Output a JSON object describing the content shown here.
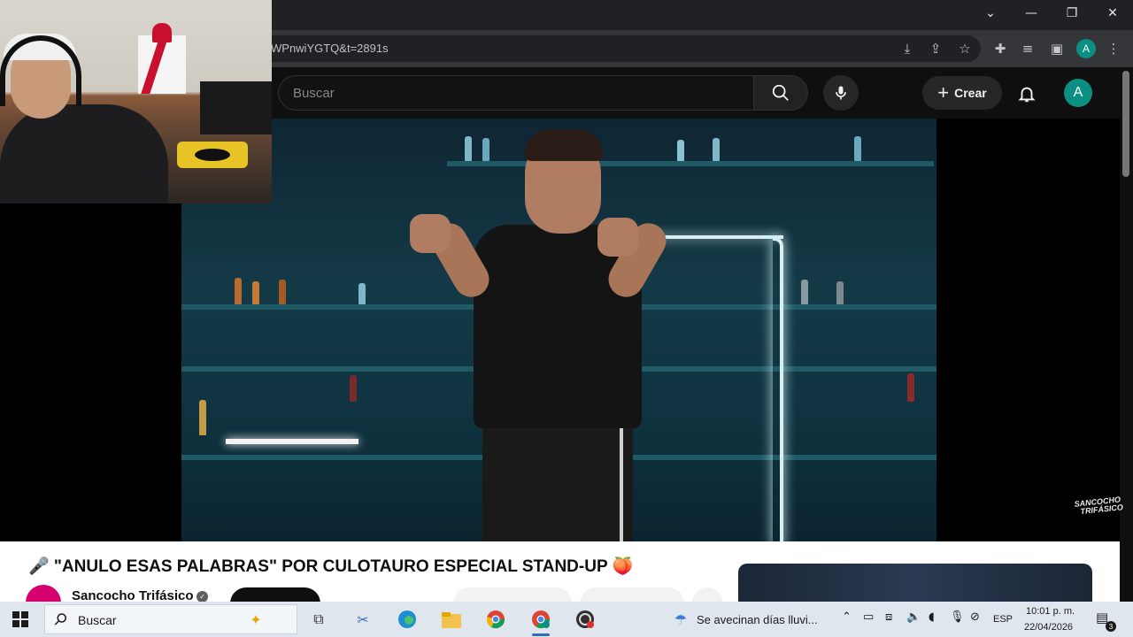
{
  "browser": {
    "url": "WPnwiYGTQ&t=2891s",
    "profile_initial": "A",
    "window_controls": [
      "chevron-down",
      "minimize",
      "restore",
      "close"
    ]
  },
  "youtube": {
    "search_placeholder": "Buscar",
    "create_label": "Crear",
    "avatar_initial": "A",
    "video_watermark_line1": "SANCOCHO",
    "video_watermark_line2": "TRIFÁSICO",
    "video_title": "🎤 \"ANULO ESAS PALABRAS\" POR CULOTAURO ESPECIAL STAND-UP 🍑",
    "channel_name": "Sancocho Trifásico"
  },
  "taskbar": {
    "search_label": "Buscar",
    "weather_text": "Se avecinan días lluvi...",
    "language": "ESP",
    "time": "10:01 p. m.",
    "date": "22/04/2026",
    "notification_count": "3"
  },
  "colors": {
    "youtube_bg": "#0f0f0f",
    "accent_teal": "#0b8f82",
    "channel_pink": "#d6006e"
  }
}
